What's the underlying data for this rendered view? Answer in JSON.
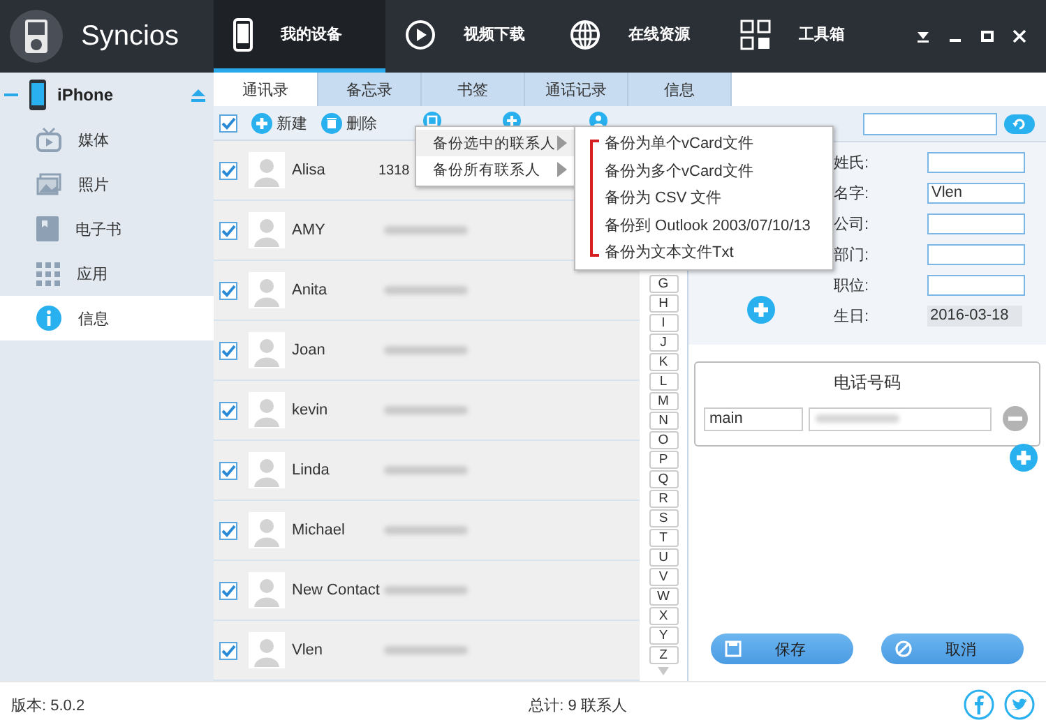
{
  "app": {
    "name": "Syncios"
  },
  "nav": [
    {
      "label": "我的设备",
      "selected": true
    },
    {
      "label": "视频下载",
      "selected": false
    },
    {
      "label": "在线资源",
      "selected": false
    },
    {
      "label": "工具箱",
      "selected": false
    }
  ],
  "sidebar": {
    "device": "iPhone",
    "items": [
      {
        "label": "媒体",
        "selected": false
      },
      {
        "label": "照片",
        "selected": false
      },
      {
        "label": "电子书",
        "selected": false
      },
      {
        "label": "应用",
        "selected": false
      },
      {
        "label": "信息",
        "selected": true
      }
    ]
  },
  "tabs": [
    {
      "label": "通讯录",
      "selected": true
    },
    {
      "label": "备忘录",
      "selected": false
    },
    {
      "label": "书签",
      "selected": false
    },
    {
      "label": "通话记录",
      "selected": false
    },
    {
      "label": "信息",
      "selected": false
    }
  ],
  "toolbar": {
    "select_all": true,
    "buttons": [
      {
        "label": "新建"
      },
      {
        "label": "删除"
      }
    ]
  },
  "contacts": [
    {
      "name": "Alisa",
      "phone": "1318",
      "checked": true
    },
    {
      "name": "AMY",
      "checked": true
    },
    {
      "name": "Anita",
      "checked": true
    },
    {
      "name": "Joan",
      "checked": true
    },
    {
      "name": "kevin",
      "checked": true
    },
    {
      "name": "Linda",
      "checked": true
    },
    {
      "name": "Michael",
      "checked": true
    },
    {
      "name": "New Contact",
      "checked": true
    },
    {
      "name": "Vlen",
      "checked": true
    }
  ],
  "index_letters": [
    "G",
    "H",
    "I",
    "J",
    "K",
    "L",
    "M",
    "N",
    "O",
    "P",
    "Q",
    "R",
    "S",
    "T",
    "U",
    "V",
    "W",
    "X",
    "Y",
    "Z"
  ],
  "menu": {
    "items": [
      {
        "label": "备份选中的联系人",
        "selected": true
      },
      {
        "label": "备份所有联系人",
        "selected": false
      }
    ],
    "submenu": [
      "备份为单个vCard文件",
      "备份为多个vCard文件",
      "备份为 CSV 文件",
      "备份到 Outlook 2003/07/10/13",
      "备份为文本文件Txt"
    ]
  },
  "detail": {
    "fields": [
      {
        "label": "姓氏:",
        "kind": "input"
      },
      {
        "label": "名字:",
        "kind": "input",
        "value": "Vlen"
      },
      {
        "label": "公司:",
        "kind": "input"
      },
      {
        "label": "部门:",
        "kind": "input"
      },
      {
        "label": "职位:",
        "kind": "input"
      },
      {
        "label": "生日:",
        "kind": "date",
        "value": "2016-03-18"
      }
    ]
  },
  "phone_section": {
    "title": "电话号码",
    "entries": [
      {
        "type": "main"
      }
    ]
  },
  "actions": [
    {
      "label": "保存"
    },
    {
      "label": "取消"
    }
  ],
  "status_bar": {
    "version": "版本: 5.0.2",
    "total": "总计: 9 联系人"
  }
}
